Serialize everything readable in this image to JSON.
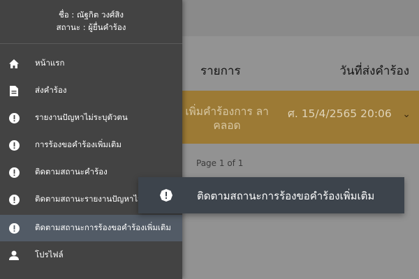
{
  "profile": {
    "name": "ชื่อ : ณัฐกิต วงศ์สิง",
    "status": "สถานะ : ผู้ยื่นคำร้อง"
  },
  "sidebar": {
    "items": [
      {
        "label": "หน้าแรก",
        "icon": "home-icon"
      },
      {
        "label": "ส่งคำร้อง",
        "icon": "document-icon"
      },
      {
        "label": "รายงานปัญหาไม่ระบุตัวตน",
        "icon": "alert-icon"
      },
      {
        "label": "การร้องขอคำร้องเพิ่มเติม",
        "icon": "alert-icon"
      },
      {
        "label": "ติดตามสถานะคำร้อง",
        "icon": "alert-icon"
      },
      {
        "label": "ติดตามสถานะรายงานปัญหาไม่ระบุ",
        "icon": "alert-icon"
      },
      {
        "label": "ติดตามสถานะการร้องขอคำร้องเพิ่มเติม",
        "icon": "alert-icon",
        "active": true
      },
      {
        "label": "โปรไฟล์",
        "icon": "user-icon"
      }
    ]
  },
  "tooltip": {
    "text": "ติดตามสถานะการร้องขอคำร้องเพิ่มเติม",
    "icon": "alert-icon"
  },
  "table": {
    "columns": [
      "รายการ",
      "วันที่ส่งคำร้อง"
    ],
    "rows": [
      {
        "item": "เพิ่มคำร้องการ ลา คลอด",
        "date": "ศ. 15/4/2565 20:06"
      }
    ],
    "pager": "Page 1 of 1"
  },
  "colors": {
    "sidebar_bg": "#434343",
    "active_item": "#525b66",
    "tooltip_bg": "#3d444c",
    "row_highlight": "#9c7a35"
  }
}
